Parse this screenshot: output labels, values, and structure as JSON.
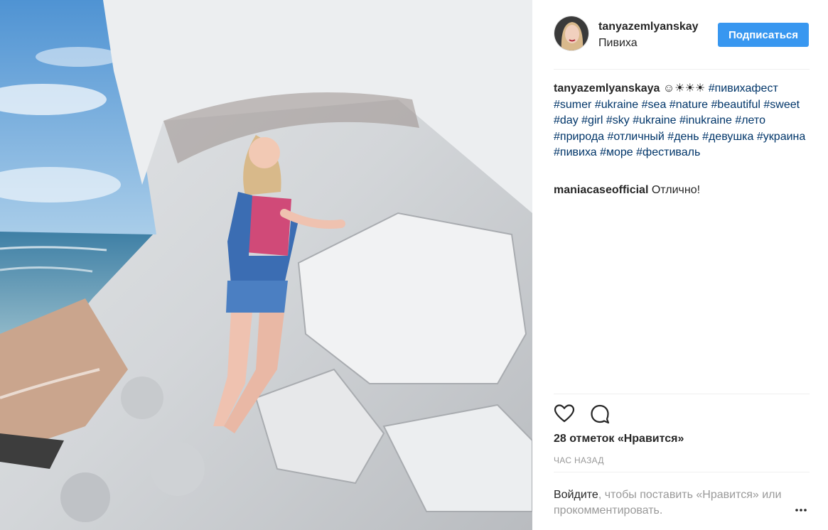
{
  "post": {
    "username": "tanyazemlyanskay",
    "location": "Пивиха",
    "follow_label": "Подписаться"
  },
  "caption": {
    "author": "tanyazemlyanskaya",
    "emoji": "☺☀☀☀",
    "hashtags": [
      "#пивихафест",
      "#sumer",
      "#ukraine",
      "#sea",
      "#nature",
      "#beautiful",
      "#sweet",
      "#day",
      "#girl",
      "#sky",
      "#ukraine",
      "#inukraine",
      "#лето",
      "#природа",
      "#отличный",
      "#день",
      "#девушка",
      "#украина",
      "#пивиха",
      "#море",
      "#фестиваль"
    ]
  },
  "comments": [
    {
      "author": "maniacaseofficial",
      "text": "Отлично!"
    }
  ],
  "actions": {
    "like_icon": "heart-icon",
    "comment_icon": "comment-bubble-icon"
  },
  "likes_text": "28 отметок «Нравится»",
  "timestamp": "ЧАС НАЗАД",
  "login_prompt": {
    "link": "Войдите",
    "text": ", чтобы поставить «Нравится» или прокомментировать."
  },
  "more_icon": "more-options-icon",
  "colors": {
    "accent": "#3897f0",
    "hashtag": "#003569",
    "muted": "#999999",
    "text": "#262626"
  }
}
